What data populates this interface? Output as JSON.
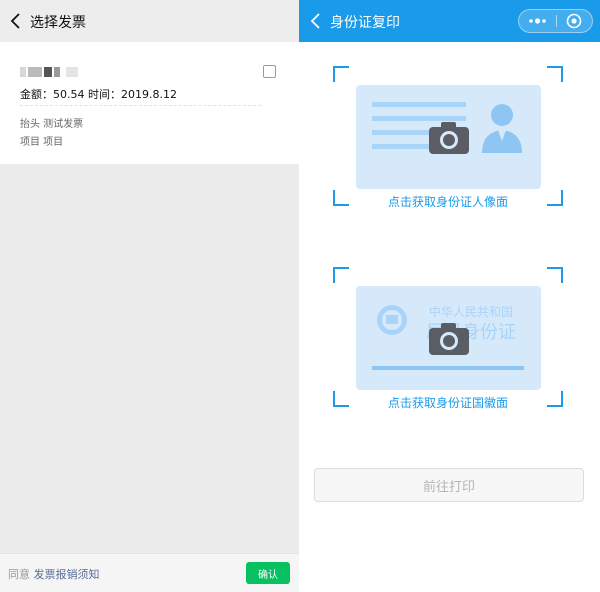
{
  "left": {
    "title": "选择发票",
    "invoice": {
      "amount_line": "金额：50.54 时间：2019.8.12",
      "header_line": "抬头 测试发票",
      "item_line": "项目 项目"
    },
    "footer": {
      "agree_prefix": "同意 ",
      "notice_link": "发票报销须知",
      "confirm_label": "确认"
    }
  },
  "right": {
    "title": "身份证复印",
    "front": {
      "label": "点击获取身份证人像面"
    },
    "back": {
      "label": "点击获取身份证国徽面",
      "card_line1": "中华人民共和国",
      "card_line2": "居民身份证"
    },
    "print_label": "前往打印"
  },
  "colors": {
    "accent": "#1a9be9",
    "confirm_green": "#07c160",
    "card_bg": "#d6e9fb",
    "card_line": "#a9d3f7",
    "camera": "#5a5e64",
    "link": "#576b95"
  },
  "icons": [
    "back-arrow-icon",
    "checkbox-icon",
    "more-dots-icon",
    "mini-program-close-icon",
    "camera-icon",
    "person-silhouette-icon",
    "national-emblem-icon"
  ]
}
